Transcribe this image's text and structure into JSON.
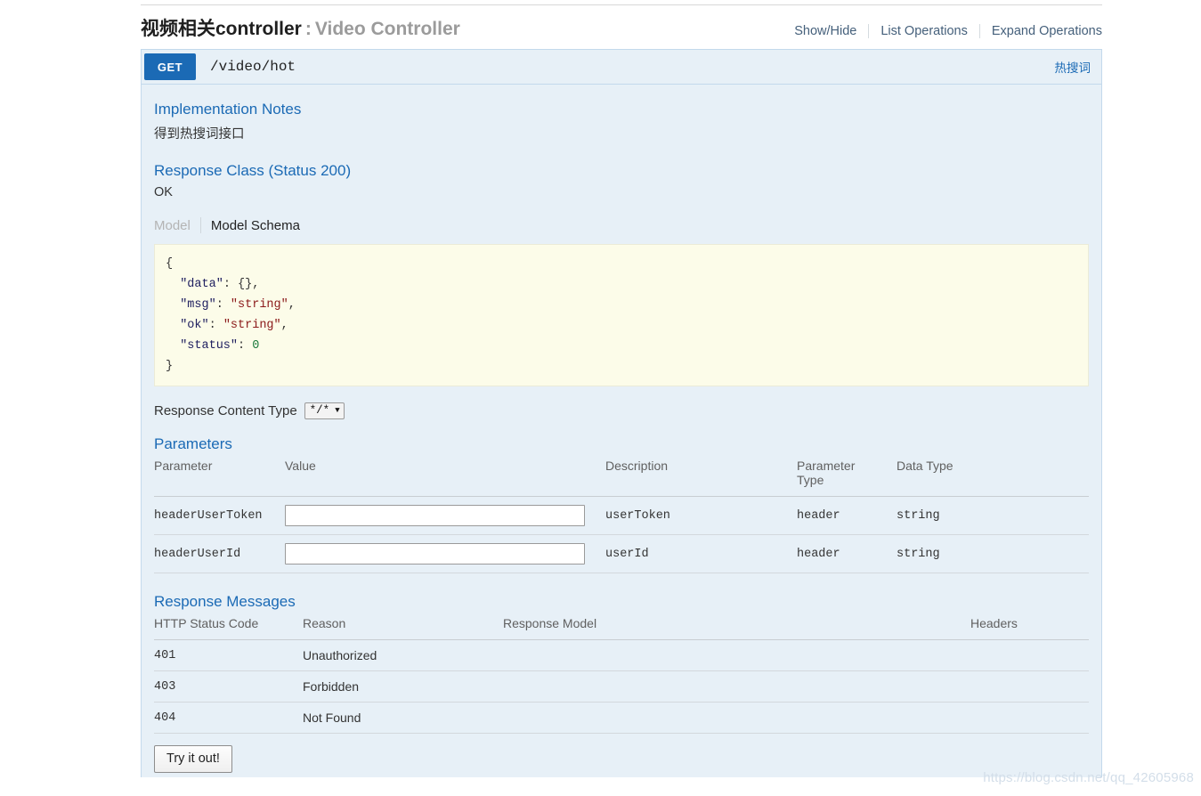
{
  "resource": {
    "tag_name": "视频相关controller",
    "separator": ":",
    "tag_description": "Video Controller",
    "options": {
      "show_hide": "Show/Hide",
      "list_operations": "List Operations",
      "expand_operations": "Expand Operations"
    }
  },
  "operation": {
    "method": "GET",
    "path": "/video/hot",
    "summary": "热搜词",
    "method_color": "#1b6ab5",
    "implementation_notes": {
      "heading": "Implementation Notes",
      "text": "得到热搜词接口"
    },
    "response_class": {
      "heading": "Response Class (Status 200)",
      "status_text": "OK",
      "tabs": [
        {
          "label": "Model",
          "active": false
        },
        {
          "label": "Model Schema",
          "active": true
        }
      ],
      "schema": {
        "open_brace": "{",
        "lines": [
          {
            "key": "\"data\"",
            "sep": ": ",
            "value": "{}",
            "value_type": "object",
            "comma": ","
          },
          {
            "key": "\"msg\"",
            "sep": ": ",
            "value": "\"string\"",
            "value_type": "string",
            "comma": ","
          },
          {
            "key": "\"ok\"",
            "sep": ": ",
            "value": "\"string\"",
            "value_type": "string",
            "comma": ","
          },
          {
            "key": "\"status\"",
            "sep": ": ",
            "value": "0",
            "value_type": "number",
            "comma": ""
          }
        ],
        "close_brace": "}"
      }
    },
    "response_content_type": {
      "label": "Response Content Type",
      "selected": "*/*",
      "options": [
        "*/*"
      ]
    },
    "parameters_section": {
      "heading": "Parameters",
      "columns": [
        "Parameter",
        "Value",
        "Description",
        "Parameter Type",
        "Data Type"
      ],
      "parameter_type_col_line1": "Parameter",
      "parameter_type_col_line2": "Type",
      "rows": [
        {
          "parameter": "headerUserToken",
          "value": "",
          "placeholder": "",
          "description": "userToken",
          "parameter_type": "header",
          "data_type": "string"
        },
        {
          "parameter": "headerUserId",
          "value": "",
          "placeholder": "",
          "description": "userId",
          "parameter_type": "header",
          "data_type": "string"
        }
      ]
    },
    "response_messages_section": {
      "heading": "Response Messages",
      "columns": [
        "HTTP Status Code",
        "Reason",
        "Response Model",
        "Headers"
      ],
      "rows": [
        {
          "code": "401",
          "reason": "Unauthorized",
          "model": "",
          "headers": ""
        },
        {
          "code": "403",
          "reason": "Forbidden",
          "model": "",
          "headers": ""
        },
        {
          "code": "404",
          "reason": "Not Found",
          "model": "",
          "headers": ""
        }
      ]
    },
    "try_button_label": "Try it out!"
  },
  "watermark": "https://blog.csdn.net/qq_42605968"
}
